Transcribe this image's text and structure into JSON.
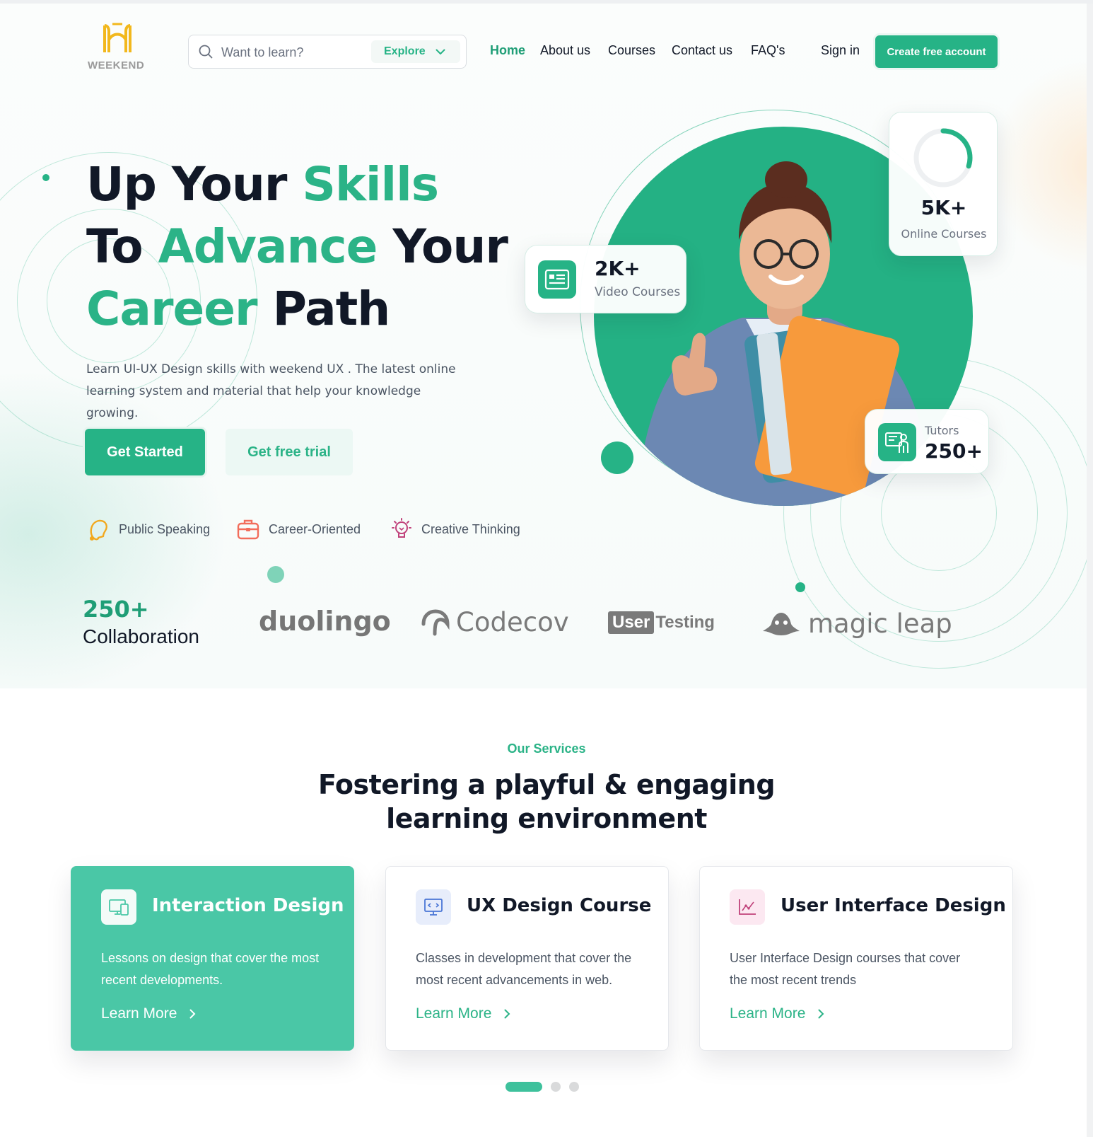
{
  "header": {
    "logo_text": "WEEKEND",
    "search": {
      "placeholder": "Want to learn?",
      "explore_label": "Explore"
    },
    "nav": [
      {
        "label": "Home",
        "active": true
      },
      {
        "label": "About us",
        "active": false
      },
      {
        "label": "Courses",
        "active": false
      },
      {
        "label": "Contact us",
        "active": false
      },
      {
        "label": "FAQ's",
        "active": false
      }
    ],
    "sign_in": "Sign in",
    "create_account": "Create free account"
  },
  "hero": {
    "title_line1": {
      "a": "Up Your ",
      "b": "Skills"
    },
    "title_line2": {
      "a": "To ",
      "b": "Advance",
      "c": " Your"
    },
    "title_line3": {
      "a": "Career",
      "b": " Path"
    },
    "description": "Learn UI-UX Design skills with weekend UX . The latest online learning system and material that help your knowledge growing.",
    "primary_button": "Get Started",
    "secondary_button": "Get free trial",
    "skills": [
      {
        "label": "Public Speaking",
        "icon": "head-speaking-icon"
      },
      {
        "label": "Career-Oriented",
        "icon": "briefcase-icon"
      },
      {
        "label": "Creative Thinking",
        "icon": "lightbulb-icon"
      }
    ]
  },
  "stats": {
    "video_courses": {
      "value": "2K+",
      "label": "Video Courses"
    },
    "online_courses": {
      "value": "5K+",
      "label": "Online Courses",
      "progress": 0.3
    },
    "tutors": {
      "value": "250+",
      "label": "Tutors"
    }
  },
  "partners": {
    "count": "250+",
    "label": "Collaboration",
    "logos": [
      {
        "name": "duolingo"
      },
      {
        "name": "Codecov"
      },
      {
        "name_a": "User",
        "name_b": "Testing"
      },
      {
        "name": "magic leap"
      }
    ]
  },
  "services": {
    "eyebrow": "Our Services",
    "title": "Fostering a playful & engaging learning environment",
    "cards": [
      {
        "title": "Interaction Design",
        "description": "Lessons on design that cover the most recent developments.",
        "link": "Learn More",
        "active": true
      },
      {
        "title": "UX Design Course",
        "description": "Classes in development that cover the most recent advancements in web.",
        "link": "Learn More",
        "active": false
      },
      {
        "title": "User Interface Design",
        "description": "User Interface Design courses that cover the most recent  trends",
        "link": "Learn More",
        "active": false
      }
    ],
    "pager": {
      "pages": 3,
      "current": 1
    }
  },
  "colors": {
    "brand": "#26b386",
    "brand_light": "#4ac7a6",
    "text": "#111827",
    "muted": "#4b5563",
    "logo": "#f2b81d"
  }
}
